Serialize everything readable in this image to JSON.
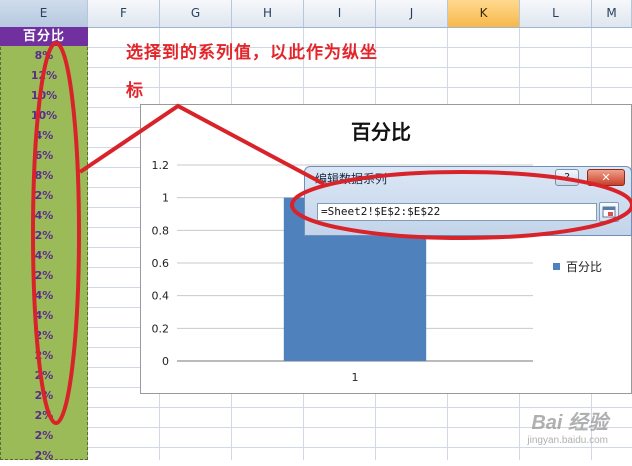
{
  "columns": [
    "E",
    "F",
    "G",
    "H",
    "I",
    "J",
    "K",
    "L",
    "M"
  ],
  "sheet": {
    "header_label": "百分比",
    "values": [
      "8%",
      "12%",
      "10%",
      "10%",
      "4%",
      "6%",
      "8%",
      "2%",
      "4%",
      "2%",
      "4%",
      "2%",
      "4%",
      "4%",
      "2%",
      "2%",
      "2%",
      "2%",
      "2%",
      "2%",
      "2%"
    ]
  },
  "annotation": {
    "line1": "选择到的系列值，以此作为纵坐",
    "line2": "标",
    "color": "#e2262c"
  },
  "chart_data": {
    "type": "bar",
    "title": "百分比",
    "categories": [
      "1"
    ],
    "series": [
      {
        "name": "百分比",
        "values": [
          1
        ],
        "color": "#4f81bd"
      }
    ],
    "ylim": [
      0,
      1.2
    ],
    "yticks": [
      "0",
      "0.2",
      "0.4",
      "0.6",
      "0.8",
      "1",
      "1.2"
    ],
    "grid": true,
    "legend": "right"
  },
  "dialog": {
    "title": "编辑数据系列",
    "help_label": "?",
    "close_label": "✕",
    "reference_value": "=Sheet2!$E$2:$E$22"
  },
  "watermark": {
    "logo": "Bai 经验",
    "url": "jingyan.baidu.com"
  },
  "colors": {
    "header_bg": "#7030a0",
    "cells_bg": "#9bbb59",
    "bar": "#4f81bd",
    "accent_ring": "#e2262c"
  }
}
